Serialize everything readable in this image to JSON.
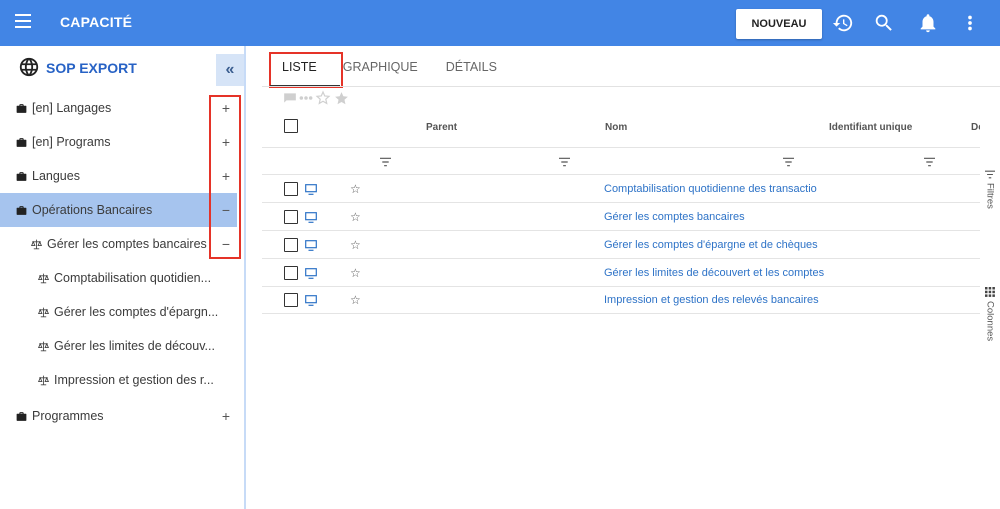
{
  "header": {
    "title": "CAPACITÉ",
    "new_button": "NOUVEAU",
    "icons": [
      "history-icon",
      "search-icon",
      "bell-icon",
      "more-vert-icon"
    ],
    "accent_color": "#4285e5"
  },
  "sidebar": {
    "title": "SOP EXPORT",
    "collapse_label": "«",
    "items": [
      {
        "label": "[en] Langages",
        "toggle": "+",
        "icon": "briefcase-icon"
      },
      {
        "label": "[en] Programs",
        "toggle": "+",
        "icon": "briefcase-icon"
      },
      {
        "label": "Langues",
        "toggle": "+",
        "icon": "briefcase-icon"
      },
      {
        "label": "Opérations Bancaires",
        "toggle": "−",
        "icon": "briefcase-icon",
        "selected": true
      },
      {
        "label": "Gérer les comptes bancaires",
        "toggle": "−",
        "icon": "scale-icon"
      },
      {
        "label": "Comptabilisation quotidien...",
        "icon": "scale-icon"
      },
      {
        "label": "Gérer les comptes d'épargn...",
        "icon": "scale-icon"
      },
      {
        "label": "Gérer les limites de découv...",
        "icon": "scale-icon"
      },
      {
        "label": "Impression et gestion des r...",
        "icon": "scale-icon"
      },
      {
        "label": "Programmes",
        "toggle": "+",
        "icon": "briefcase-icon"
      }
    ]
  },
  "tabs": [
    {
      "label": "LISTE",
      "active": true
    },
    {
      "label": "GRAPHIQUE"
    },
    {
      "label": "DÉTAILS"
    }
  ],
  "grid": {
    "columns": [
      "Parent",
      "Nom",
      "Identifiant unique",
      "De"
    ],
    "rows": [
      {
        "name": "Comptabilisation quotidienne des transactio"
      },
      {
        "name": "Gérer les comptes bancaires"
      },
      {
        "name": "Gérer les comptes d'épargne et de chèques"
      },
      {
        "name": "Gérer les limites de découvert et les comptes"
      },
      {
        "name": "Impression et gestion des relevés bancaires"
      }
    ]
  },
  "side_panel": {
    "filters_label": "Filtres",
    "columns_label": "Colonnes"
  }
}
